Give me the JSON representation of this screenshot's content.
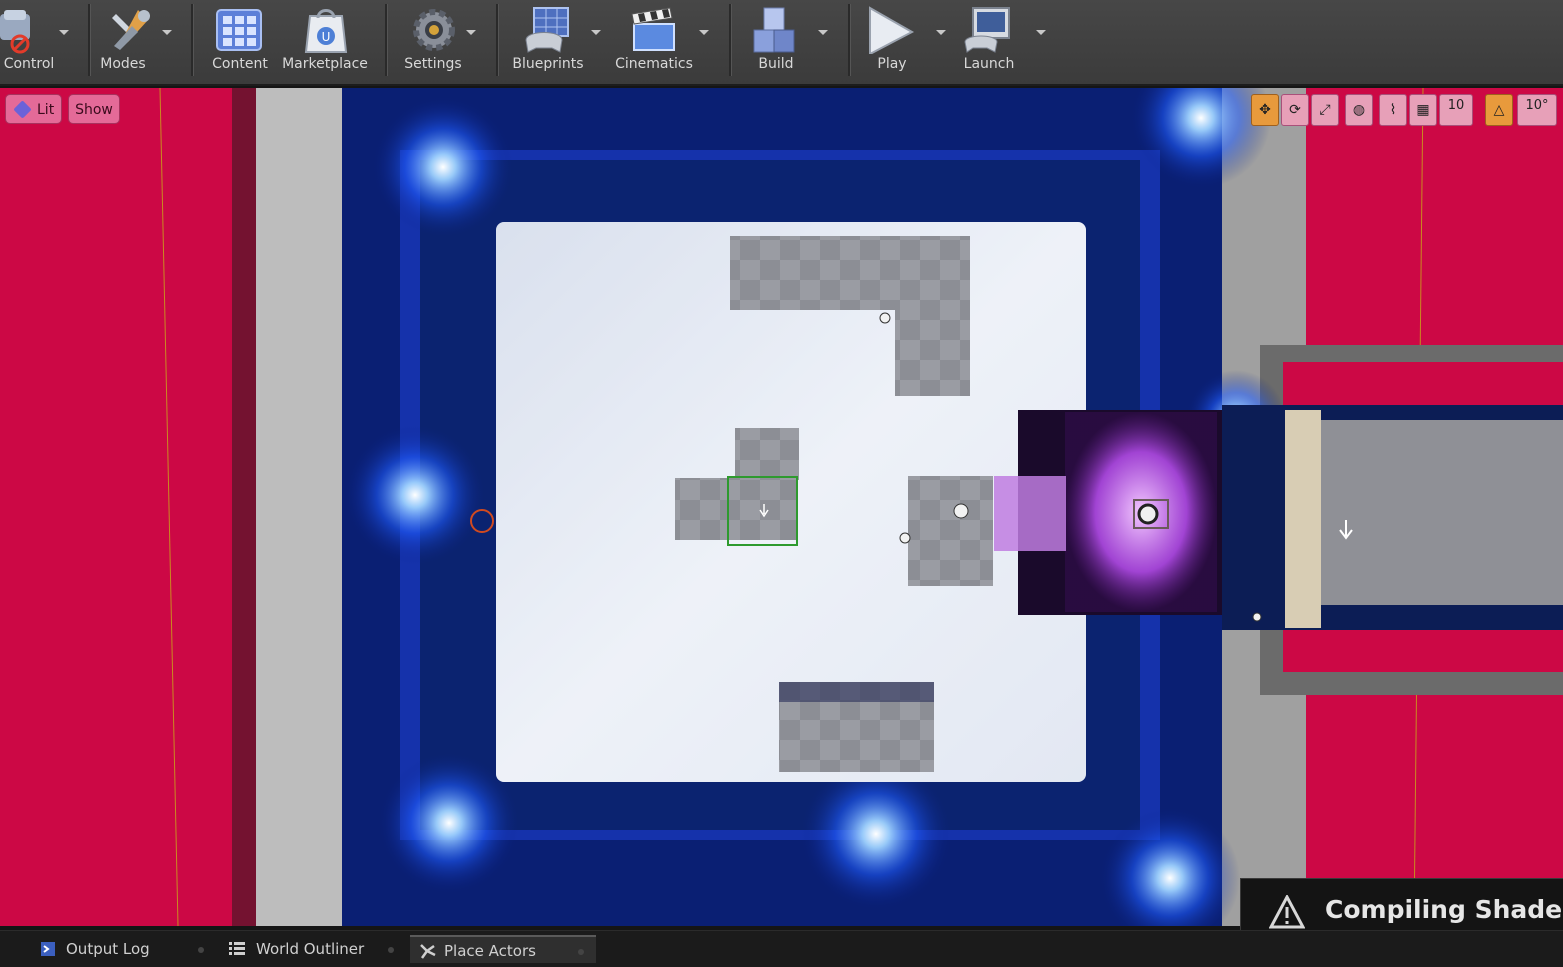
{
  "toolbar": {
    "items": [
      {
        "label": "Control",
        "icon": "source-control-icon"
      },
      {
        "label": "Modes",
        "icon": "modes-tools-icon"
      },
      {
        "label": "Content",
        "icon": "content-grid-icon"
      },
      {
        "label": "Marketplace",
        "icon": "marketplace-bag-icon"
      },
      {
        "label": "Settings",
        "icon": "settings-gears-icon"
      },
      {
        "label": "Blueprints",
        "icon": "blueprints-gamepad-icon"
      },
      {
        "label": "Cinematics",
        "icon": "cinematics-clapper-icon"
      },
      {
        "label": "Build",
        "icon": "build-blocks-icon"
      },
      {
        "label": "Play",
        "icon": "play-triangle-icon"
      },
      {
        "label": "Launch",
        "icon": "launch-device-icon"
      }
    ]
  },
  "viewport": {
    "lit_label": "Lit",
    "show_label": "Show",
    "grid_snap_value": "10",
    "rotation_snap_value": "10°"
  },
  "notification": {
    "message": "Compiling Shaders (",
    "icon": "warning-icon"
  },
  "bottom_tabs": [
    {
      "label": "Output Log",
      "icon": "output-log-icon"
    },
    {
      "label": "World Outliner",
      "icon": "world-outliner-icon"
    },
    {
      "label": "Place Actors",
      "icon": "place-actors-icon",
      "active": true
    }
  ],
  "colors": {
    "accent_magenta": "#cc0845",
    "glow_blue": "#1a4fff",
    "glow_purple": "#b040ff",
    "toolbar_bg": "#3f3f3f"
  }
}
